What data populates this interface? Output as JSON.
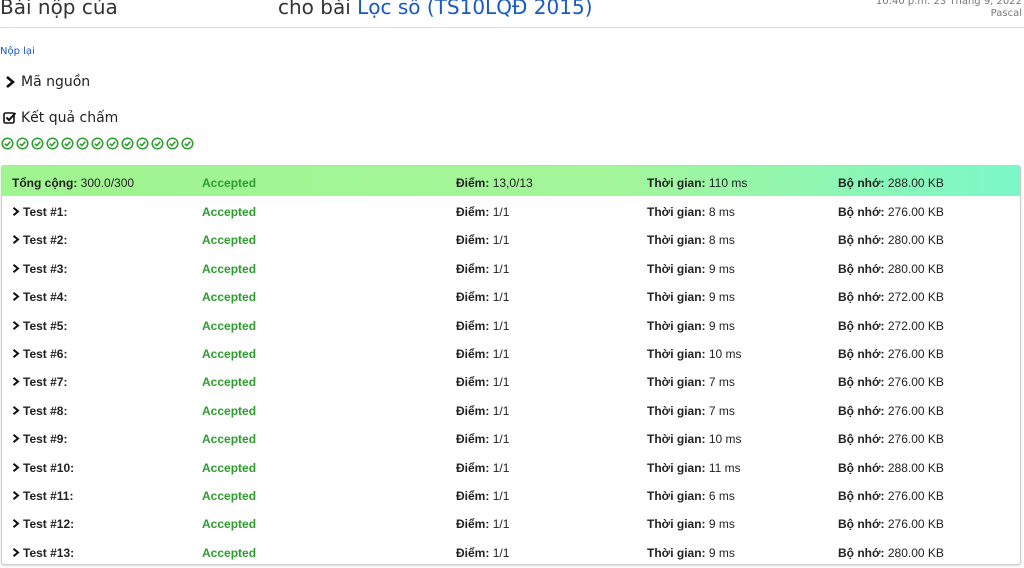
{
  "header": {
    "title_prefix": "Bài nộp của",
    "title_middle": "cho bài",
    "problem_name": "Lọc số (TS10LQĐ 2015)",
    "timestamp": "10:40 p.m. 23 Tháng 9, 2022",
    "language": "Pascal"
  },
  "actions": {
    "resubmit": "Nộp lại"
  },
  "sections": {
    "source": "Mã nguồn",
    "results": "Kết quả chấm"
  },
  "check_count": 13,
  "labels": {
    "points": "Điểm:",
    "time": "Thời gian:",
    "memory": "Bộ nhớ:"
  },
  "summary": {
    "label": "Tổng cộng:",
    "score": "300.0/300",
    "status": "Accepted",
    "points": "13,0/13",
    "time": "110 ms",
    "memory": "288.00 KB"
  },
  "tests": [
    {
      "name": "Test #1:",
      "status": "Accepted",
      "points": "1/1",
      "time": "8 ms",
      "memory": "276.00 KB"
    },
    {
      "name": "Test #2:",
      "status": "Accepted",
      "points": "1/1",
      "time": "8 ms",
      "memory": "280.00 KB"
    },
    {
      "name": "Test #3:",
      "status": "Accepted",
      "points": "1/1",
      "time": "9 ms",
      "memory": "280.00 KB"
    },
    {
      "name": "Test #4:",
      "status": "Accepted",
      "points": "1/1",
      "time": "9 ms",
      "memory": "272.00 KB"
    },
    {
      "name": "Test #5:",
      "status": "Accepted",
      "points": "1/1",
      "time": "9 ms",
      "memory": "272.00 KB"
    },
    {
      "name": "Test #6:",
      "status": "Accepted",
      "points": "1/1",
      "time": "10 ms",
      "memory": "276.00 KB"
    },
    {
      "name": "Test #7:",
      "status": "Accepted",
      "points": "1/1",
      "time": "7 ms",
      "memory": "276.00 KB"
    },
    {
      "name": "Test #8:",
      "status": "Accepted",
      "points": "1/1",
      "time": "7 ms",
      "memory": "276.00 KB"
    },
    {
      "name": "Test #9:",
      "status": "Accepted",
      "points": "1/1",
      "time": "10 ms",
      "memory": "276.00 KB"
    },
    {
      "name": "Test #10:",
      "status": "Accepted",
      "points": "1/1",
      "time": "11 ms",
      "memory": "288.00 KB"
    },
    {
      "name": "Test #11:",
      "status": "Accepted",
      "points": "1/1",
      "time": "6 ms",
      "memory": "276.00 KB"
    },
    {
      "name": "Test #12:",
      "status": "Accepted",
      "points": "1/1",
      "time": "9 ms",
      "memory": "276.00 KB"
    },
    {
      "name": "Test #13:",
      "status": "Accepted",
      "points": "1/1",
      "time": "9 ms",
      "memory": "280.00 KB"
    }
  ],
  "colors": {
    "link": "#1958c7",
    "accepted": "#2d9d2d",
    "summary_start": "#9ff58f",
    "summary_end": "#7cf7c8"
  },
  "icons": {
    "source": "chevron-right-icon",
    "results": "checkbox-checked-icon",
    "test_passed": "check-circle-icon",
    "expand": "chevron-right-icon"
  }
}
